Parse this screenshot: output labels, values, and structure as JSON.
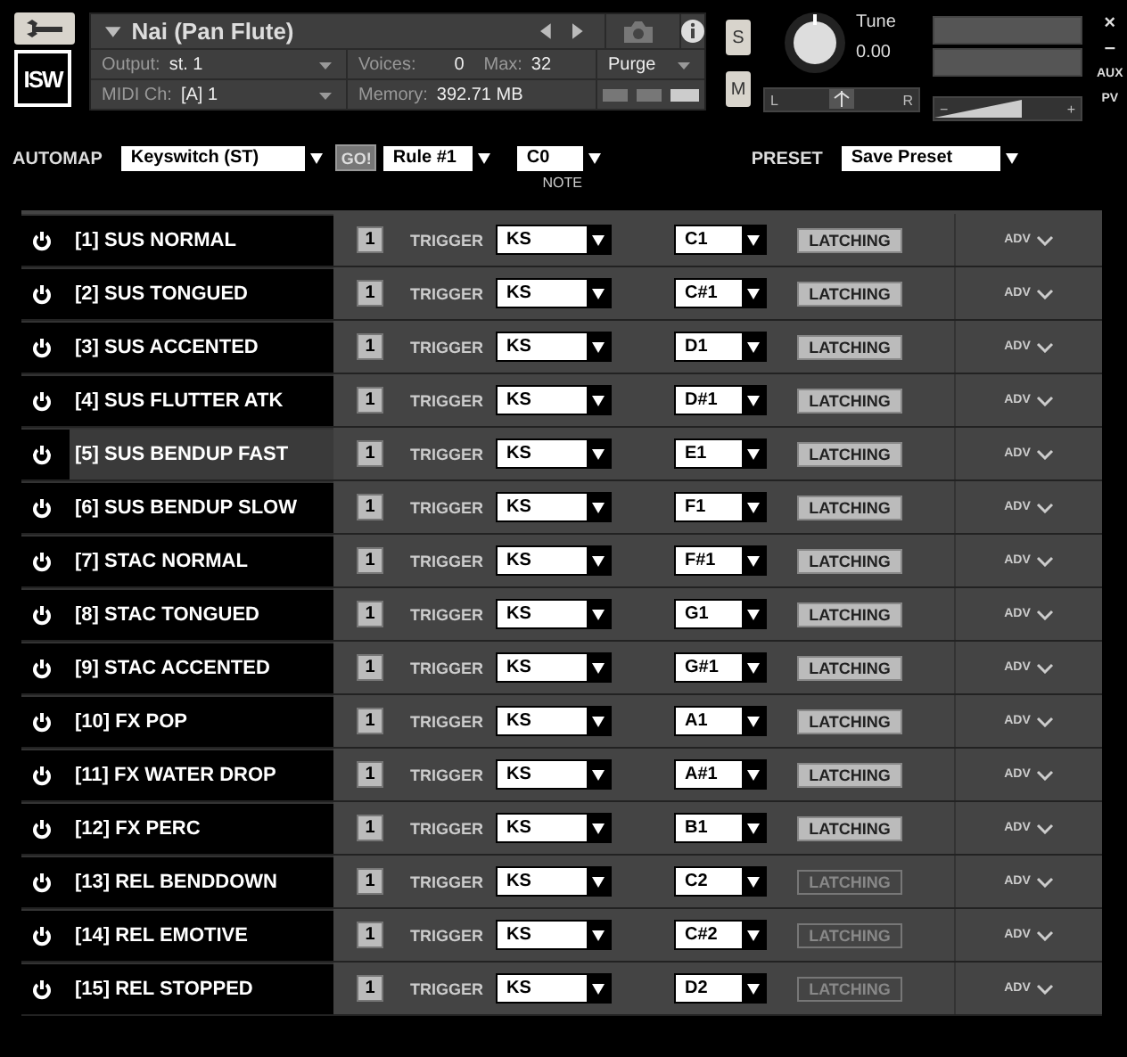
{
  "header": {
    "instrument": "Nai (Pan Flute)",
    "output_label": "Output:",
    "output": "st. 1",
    "midi_label": "MIDI Ch:",
    "midi": "[A] 1",
    "voices_label": "Voices:",
    "voices": "0",
    "max_label": "Max:",
    "max": "32",
    "memory_label": "Memory:",
    "memory": "392.71 MB",
    "purge": "Purge",
    "solo": "S",
    "mute": "M",
    "tune_label": "Tune",
    "tune": "0.00",
    "pan_left": "L",
    "pan_right": "R",
    "pan": {
      "level": 0.5
    },
    "volume": {
      "level": 0.6
    },
    "vol_minus": "−",
    "vol_plus": "+",
    "close": "×",
    "minimize": "–",
    "aux": "AUX",
    "pv": "PV",
    "logo": "ISW"
  },
  "automap": {
    "label": "AUTOMAP",
    "mode": "Keyswitch (ST)",
    "go": "GO!",
    "rule": "Rule #1",
    "note": "C0",
    "note_label": "NOTE",
    "preset_label": "PRESET",
    "preset": "Save Preset"
  },
  "articulations": [
    {
      "name": "[1] SUS NORMAL",
      "selected": false,
      "channel": "1",
      "trigger": "TRIGGER",
      "type": "KS",
      "key": "C1",
      "latching": "LATCHING",
      "latching_disabled": false,
      "adv": "ADV"
    },
    {
      "name": "[2] SUS TONGUED",
      "selected": false,
      "channel": "1",
      "trigger": "TRIGGER",
      "type": "KS",
      "key": "C#1",
      "latching": "LATCHING",
      "latching_disabled": false,
      "adv": "ADV"
    },
    {
      "name": "[3] SUS ACCENTED",
      "selected": false,
      "channel": "1",
      "trigger": "TRIGGER",
      "type": "KS",
      "key": "D1",
      "latching": "LATCHING",
      "latching_disabled": false,
      "adv": "ADV"
    },
    {
      "name": "[4] SUS FLUTTER ATK",
      "selected": false,
      "channel": "1",
      "trigger": "TRIGGER",
      "type": "KS",
      "key": "D#1",
      "latching": "LATCHING",
      "latching_disabled": false,
      "adv": "ADV"
    },
    {
      "name": "[5] SUS BENDUP FAST",
      "selected": true,
      "channel": "1",
      "trigger": "TRIGGER",
      "type": "KS",
      "key": "E1",
      "latching": "LATCHING",
      "latching_disabled": false,
      "adv": "ADV"
    },
    {
      "name": "[6] SUS BENDUP SLOW",
      "selected": false,
      "channel": "1",
      "trigger": "TRIGGER",
      "type": "KS",
      "key": "F1",
      "latching": "LATCHING",
      "latching_disabled": false,
      "adv": "ADV"
    },
    {
      "name": "[7] STAC NORMAL",
      "selected": false,
      "channel": "1",
      "trigger": "TRIGGER",
      "type": "KS",
      "key": "F#1",
      "latching": "LATCHING",
      "latching_disabled": false,
      "adv": "ADV"
    },
    {
      "name": "[8] STAC TONGUED",
      "selected": false,
      "channel": "1",
      "trigger": "TRIGGER",
      "type": "KS",
      "key": "G1",
      "latching": "LATCHING",
      "latching_disabled": false,
      "adv": "ADV"
    },
    {
      "name": "[9] STAC ACCENTED",
      "selected": false,
      "channel": "1",
      "trigger": "TRIGGER",
      "type": "KS",
      "key": "G#1",
      "latching": "LATCHING",
      "latching_disabled": false,
      "adv": "ADV"
    },
    {
      "name": "[10] FX POP",
      "selected": false,
      "channel": "1",
      "trigger": "TRIGGER",
      "type": "KS",
      "key": "A1",
      "latching": "LATCHING",
      "latching_disabled": false,
      "adv": "ADV"
    },
    {
      "name": "[11] FX WATER DROP",
      "selected": false,
      "channel": "1",
      "trigger": "TRIGGER",
      "type": "KS",
      "key": "A#1",
      "latching": "LATCHING",
      "latching_disabled": false,
      "adv": "ADV"
    },
    {
      "name": "[12] FX PERC",
      "selected": false,
      "channel": "1",
      "trigger": "TRIGGER",
      "type": "KS",
      "key": "B1",
      "latching": "LATCHING",
      "latching_disabled": false,
      "adv": "ADV"
    },
    {
      "name": "[13] REL BENDDOWN",
      "selected": false,
      "channel": "1",
      "trigger": "TRIGGER",
      "type": "KS",
      "key": "C2",
      "latching": "LATCHING",
      "latching_disabled": true,
      "adv": "ADV"
    },
    {
      "name": "[14] REL EMOTIVE",
      "selected": false,
      "channel": "1",
      "trigger": "TRIGGER",
      "type": "KS",
      "key": "C#2",
      "latching": "LATCHING",
      "latching_disabled": true,
      "adv": "ADV"
    },
    {
      "name": "[15] REL STOPPED",
      "selected": false,
      "channel": "1",
      "trigger": "TRIGGER",
      "type": "KS",
      "key": "D2",
      "latching": "LATCHING",
      "latching_disabled": true,
      "adv": "ADV"
    }
  ]
}
